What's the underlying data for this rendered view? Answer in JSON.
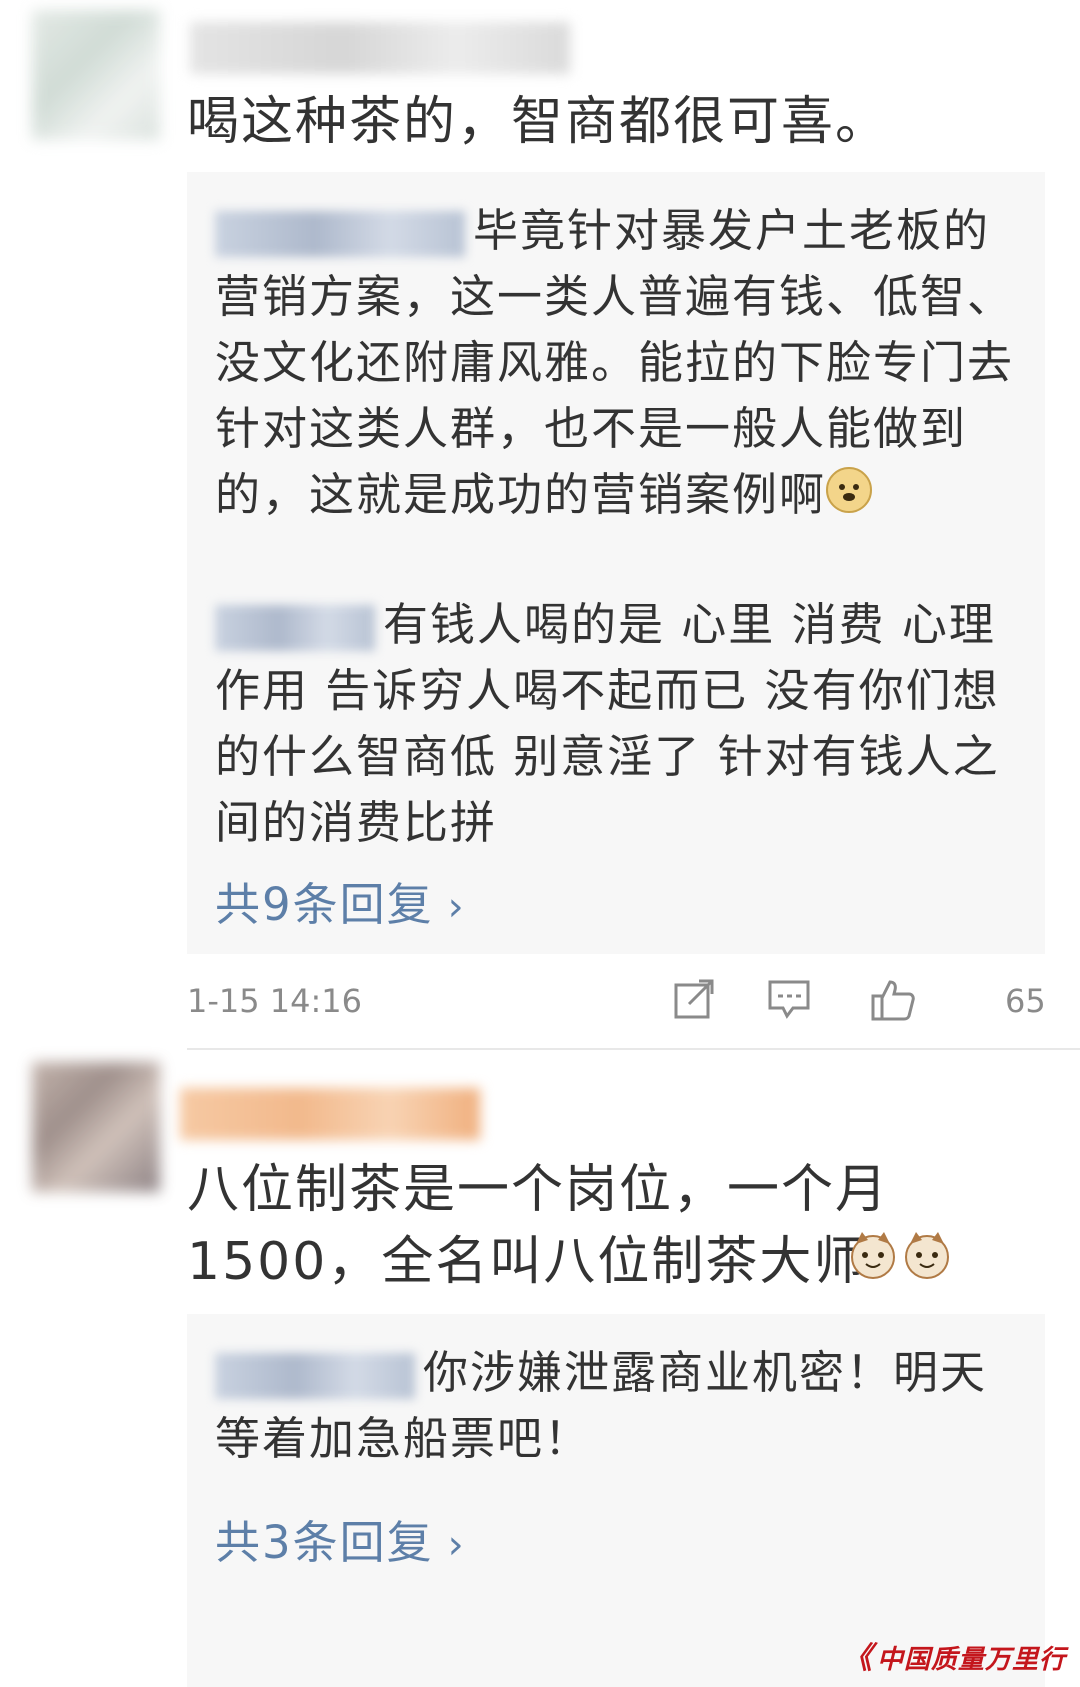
{
  "comments": [
    {
      "text": "喝这种茶的，智商都很可喜。",
      "replies": [
        {
          "text": "毕竟针对暴发户土老板的营销方案，这一类人普遍有钱、低智、没文化还附庸风雅。能拉的下脸专门去针对这类人群，也不是一般人能做到的，这就是成功的营销案例啊"
        },
        {
          "text": "有钱人喝的是  心里  消费  心理作用  告诉穷人喝不起而已  没有你们想的什么智商低   别意淫了  针对有钱人之间的消费比拼"
        }
      ],
      "more_replies": "共9条回复",
      "time": "1-15 14:16",
      "likes": "65"
    },
    {
      "text": "八位制茶是一个岗位，一个月1500，全名叫八位制茶大师",
      "replies": [
        {
          "text": "你涉嫌泄露商业机密！明天等着加急船票吧！"
        }
      ],
      "more_replies": "共3条回复"
    }
  ],
  "icons": {
    "share": "share-icon",
    "comment": "comment-icon",
    "like": "thumbs-up-icon",
    "chevron": "chevron-right-icon"
  },
  "watermark": "中国质量万里行",
  "colors": {
    "link": "#5d7fa8",
    "meta": "#8a8a8a",
    "reply_bg": "#f7f7f7",
    "watermark": "#c4161c"
  }
}
